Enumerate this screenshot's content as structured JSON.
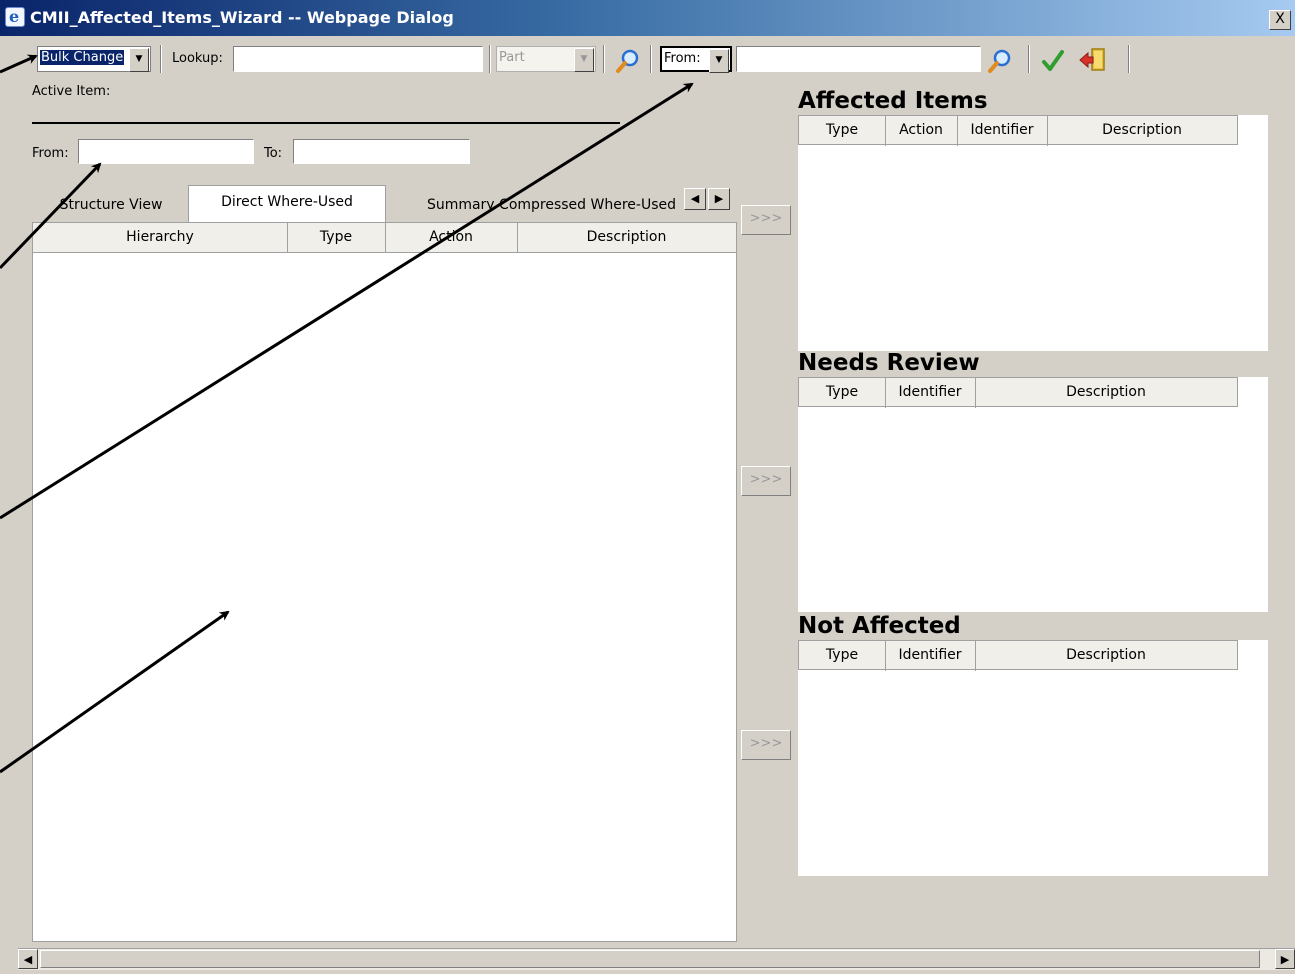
{
  "window": {
    "title": "CMII_Affected_Items_Wizard -- Webpage Dialog",
    "close_glyph": "X"
  },
  "toolbar": {
    "mode_value": "Bulk Change",
    "lookup_label": "Lookup:",
    "lookup_value": "",
    "type_value": "Part",
    "direction_value": "From:",
    "search2_value": ""
  },
  "active_item": {
    "label": "Active Item:",
    "from_label": "From:",
    "to_label": "To:",
    "from_value": "",
    "to_value": ""
  },
  "tabs": [
    {
      "label": "Structure View",
      "active": false
    },
    {
      "label": "Direct Where-Used",
      "active": true
    },
    {
      "label": "Summary Compressed Where-Used",
      "active": false
    }
  ],
  "main_grid": {
    "columns": [
      "Hierarchy",
      "Type",
      "Action",
      "Description"
    ]
  },
  "move_button_label": ">>>",
  "affected_items": {
    "title": "Affected Items",
    "columns": [
      "Type",
      "Action",
      "Identifier",
      "Description"
    ]
  },
  "needs_review": {
    "title": "Needs Review",
    "columns": [
      "Type",
      "Identifier",
      "Description"
    ]
  },
  "not_affected": {
    "title": "Not Affected",
    "columns": [
      "Type",
      "Identifier",
      "Description"
    ]
  },
  "colors": {
    "title_bar_start": "#0a246a",
    "title_bar_end": "#a6caf0",
    "window_bg": "#d4d0c8",
    "selection": "#0a246a",
    "check_green": "#2f9e2f"
  },
  "icons": [
    "ie-icon",
    "search-icon",
    "search-icon",
    "check-icon",
    "exit-icon",
    "dropdown-arrow-icon",
    "scroll-left-icon",
    "scroll-right-icon"
  ]
}
